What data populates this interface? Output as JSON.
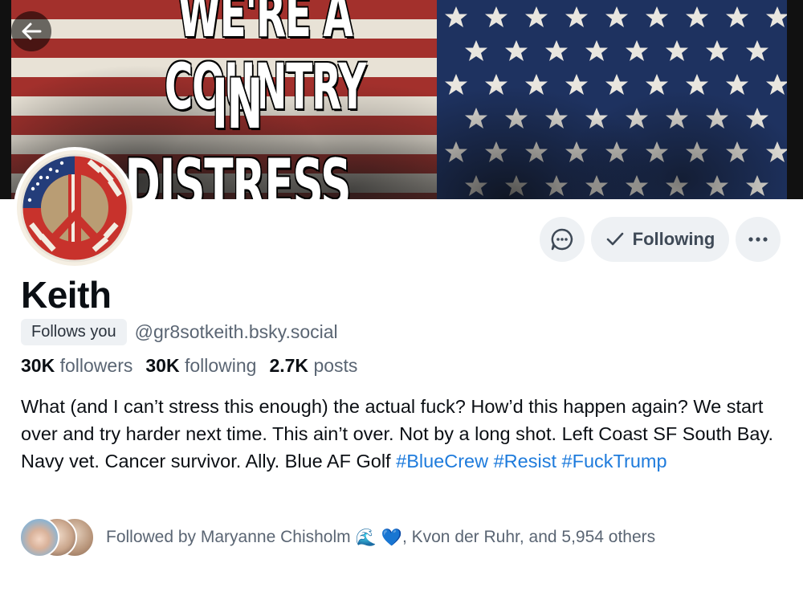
{
  "banner": {
    "line1": "WE'RE A COUNTRY",
    "line2": "IN DISTRESS"
  },
  "profile": {
    "display_name": "Keith",
    "follows_you_badge": "Follows you",
    "handle": "@gr8sotkeith.bsky.social",
    "stats": {
      "followers_count": "30K",
      "followers_label": "followers",
      "following_count": "30K",
      "following_label": "following",
      "posts_count": "2.7K",
      "posts_label": "posts"
    },
    "bio": {
      "text": "What (and I can’t stress this enough) the actual fuck? How’d this happen again? We start over and try harder next time. This ain’t over. Not by a long shot. Left Coast SF South Bay. Navy vet. Cancer survivor. Ally. Blue AF Golf ",
      "tag1": "#BlueCrew",
      "tag2": "#Resist",
      "tag3": "#FuckTrump"
    },
    "followed_by": {
      "prefix": "Followed by Maryanne Chisholm",
      "wave_emoji": "🌊",
      "heart_emoji": "💙",
      "suffix": ", Kvon der Ruhr, and 5,954 others"
    }
  },
  "actions": {
    "following_label": "Following"
  },
  "colors": {
    "link": "#1e7bdc",
    "button_bg": "#eef1f4",
    "muted_text": "#5a6573"
  },
  "icons": {
    "back": "arrow-left-icon",
    "message": "chat-bubble-icon",
    "check": "check-icon",
    "more": "ellipsis-icon"
  }
}
